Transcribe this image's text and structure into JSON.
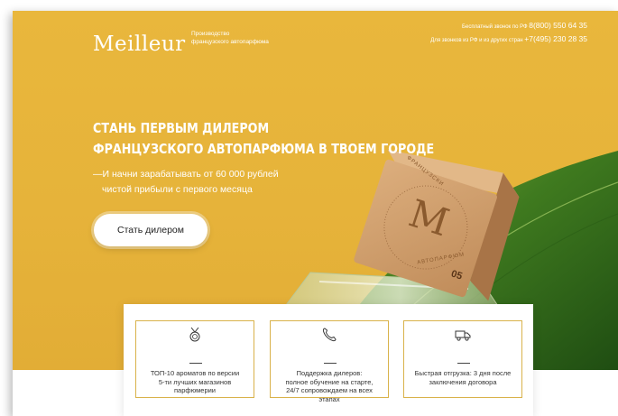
{
  "header": {
    "logo": "Meilleur",
    "tagline_line1": "Производство",
    "tagline_line2": "французского автопарфюма",
    "phone_free_label": "Бесплатный звонок по РФ",
    "phone_free_number": "8(800) 550 64 35",
    "phone_intl_label": "Для звонков из РФ и из других стран",
    "phone_intl_number": "+7(495) 230 28 35"
  },
  "hero": {
    "headline_line1": "СТАНЬ ПЕРВЫМ ДИЛЕРОМ",
    "headline_line2": "ФРАНЦУЗСКОГО АВТОПАРФЮМА В ТВОЕМ ГОРОДЕ",
    "sub_line1": "—И начни зарабатывать от 60 000 рублей",
    "sub_line2": "чистой прибыли с первого месяца",
    "cta_label": "Стать дилером"
  },
  "product": {
    "cube_letter": "M",
    "cube_top_text": "ФРАНЦУЗСКИ",
    "cube_bottom_text": "АВТОПАРФЮМ",
    "cube_number": "05"
  },
  "features": [
    {
      "icon": "medal-icon",
      "text_line1": "ТОП-10 ароматов по версии",
      "text_line2": "5-ти лучших магазинов",
      "text_line3": "парфюмерии",
      "text_line4": ""
    },
    {
      "icon": "phone-icon",
      "text_line1": "Поддержка дилеров:",
      "text_line2": "полное обучение на старте,",
      "text_line3": "24/7 сопровождаем на всех",
      "text_line4": "этапах"
    },
    {
      "icon": "truck-icon",
      "text_line1": "Быстрая отгрузка: 3 дня после",
      "text_line2": "заключения договора",
      "text_line3": "",
      "text_line4": ""
    }
  ],
  "colors": {
    "hero_background": "#e6b33a",
    "card_border": "#d9b24a",
    "leaf": "#3f7a1f",
    "cube": "#cf9f6d"
  }
}
